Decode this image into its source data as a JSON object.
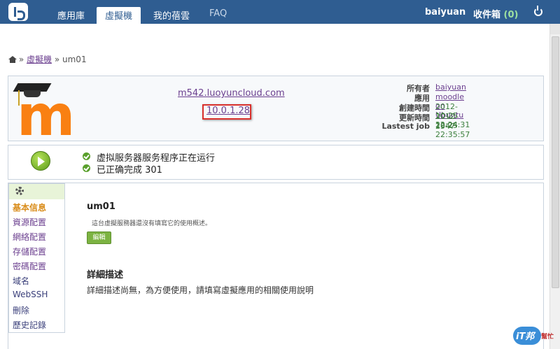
{
  "nav": {
    "tabs": [
      {
        "label": "應用庫"
      },
      {
        "label": "虛擬機"
      },
      {
        "label": "我的蓓雲"
      },
      {
        "label": "FAQ"
      }
    ],
    "username": "baiyuan",
    "inbox_label": "收件箱",
    "inbox_count": "(0)"
  },
  "breadcrumb": {
    "sep1": "»",
    "parent": "虛擬機",
    "sep2": "»",
    "current": "um01"
  },
  "info": {
    "hostname": "m542.luoyuncloud.com",
    "ip": "10.0.1.28",
    "meta": [
      {
        "label": "所有者",
        "value": "baiyuan",
        "link": true
      },
      {
        "label": "應用",
        "value": "moodle on Ubuntu",
        "link": true
      },
      {
        "label": "創建時間",
        "value": "2012-10-25 22:24:31",
        "link": false
      },
      {
        "label": "更新時間",
        "value": "2012-10-25 22:35:57",
        "link": false
      },
      {
        "label": "Lastest job",
        "value": "2547",
        "link": false
      }
    ]
  },
  "status": {
    "line1": "虚拟服务器服务程序正在运行",
    "line2": "已正确完成 301"
  },
  "sidebar": {
    "items": [
      {
        "label": "基本信息"
      },
      {
        "label": "資源配置"
      },
      {
        "label": "網絡配置"
      },
      {
        "label": "存儲配置"
      },
      {
        "label": "密碼配置"
      },
      {
        "label": "域名"
      },
      {
        "label": "WebSSH"
      },
      {
        "label": "刪除"
      },
      {
        "label": "歷史記錄"
      }
    ]
  },
  "main": {
    "vm_name": "um01",
    "vm_desc": "這台虛擬服務器還沒有填寫它的使用概述。",
    "edit_label": "編輯",
    "detail_title": "詳細描述",
    "detail_text": "詳細描述尚無，為方便使用，請填寫虛擬應用的相關使用說明"
  },
  "watermark": {
    "text1": "iT邦",
    "text2": "幫忙"
  }
}
